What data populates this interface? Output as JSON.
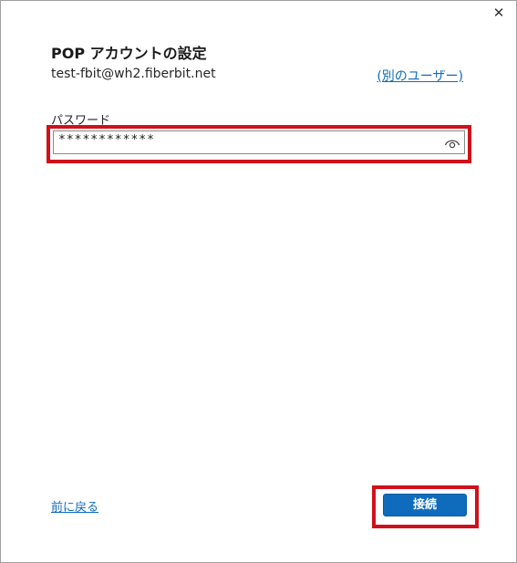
{
  "dialog": {
    "close_label": "✕",
    "title": "POP アカウントの設定",
    "email": "test-fbit@wh2.fiberbit.net",
    "other_user_label": "(別のユーザー)"
  },
  "password": {
    "label": "パスワード",
    "value": "************",
    "reveal_icon": "eye-icon"
  },
  "footer": {
    "back_label": "前に戻る",
    "connect_label": "接続"
  },
  "colors": {
    "accent": "#0f6cbd",
    "highlight": "#d0111b"
  }
}
